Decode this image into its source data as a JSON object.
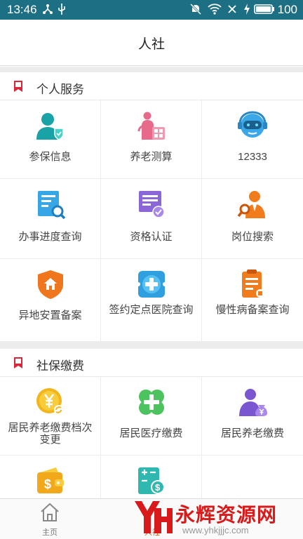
{
  "statusbar": {
    "time": "13:46",
    "battery": "100",
    "icons": [
      "network-share-icon",
      "usb-icon",
      "mute-icon",
      "wifi-icon",
      "close-x-icon",
      "charging-icon",
      "battery-icon"
    ]
  },
  "header": {
    "title": "人社"
  },
  "colors": {
    "statusbar": "#1d6f84",
    "section_flag": "#d9263b",
    "accent": "#e05a00"
  },
  "sections": [
    {
      "title": "个人服务",
      "items": [
        {
          "label": "参保信息",
          "icon": "insured-person-icon"
        },
        {
          "label": "养老测算",
          "icon": "pension-calculator-icon"
        },
        {
          "label": "12333",
          "icon": "hotline-robot-icon"
        },
        {
          "label": "办事进度查询",
          "icon": "progress-search-icon"
        },
        {
          "label": "资格认证",
          "icon": "qualification-cert-icon"
        },
        {
          "label": "岗位搜索",
          "icon": "job-search-icon"
        },
        {
          "label": "异地安置备案",
          "icon": "relocation-house-icon"
        },
        {
          "label": "签约定点医院查询",
          "icon": "hospital-cross-icon"
        },
        {
          "label": "慢性病备案查询",
          "icon": "clipboard-icon"
        }
      ]
    },
    {
      "title": "社保缴费",
      "items": [
        {
          "label": "居民养老缴费档次变更",
          "icon": "yuan-coin-icon"
        },
        {
          "label": "居民医疗缴费",
          "icon": "medical-clover-icon"
        },
        {
          "label": "居民养老缴费",
          "icon": "elder-moneybag-icon"
        },
        {
          "label": "",
          "icon": "wallet-icon"
        },
        {
          "label": "",
          "icon": "payment-calculator-icon"
        }
      ]
    }
  ],
  "bottomnav": {
    "home_label": "主页",
    "second_label": "人社"
  },
  "watermark": {
    "main": "永辉资源网",
    "url": "www.yhkjjjc.com"
  }
}
